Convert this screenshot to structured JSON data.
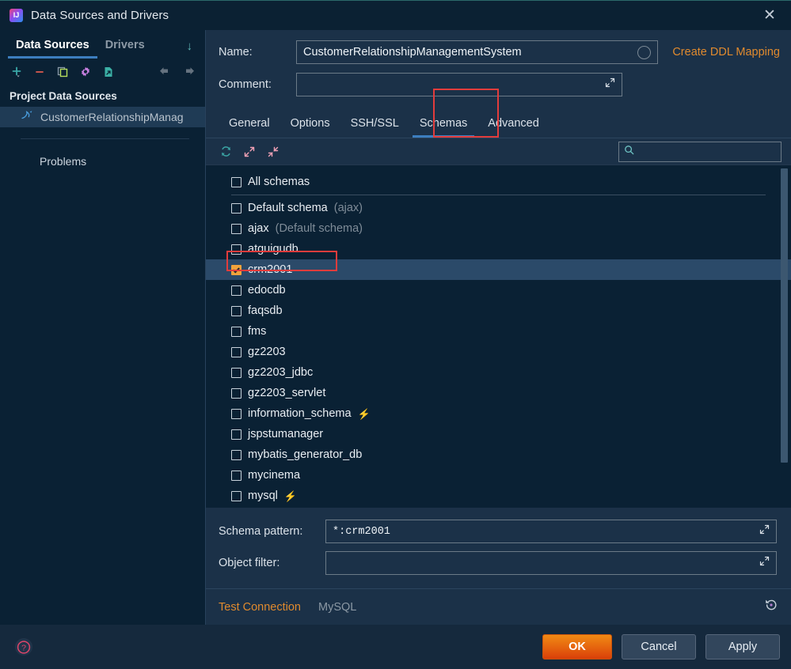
{
  "window": {
    "title": "Data Sources and Drivers",
    "app_icon": "intellij-idea-icon",
    "close_label": "✕"
  },
  "sidebar": {
    "tabs": [
      {
        "label": "Data Sources",
        "active": true
      },
      {
        "label": "Drivers",
        "active": false
      }
    ],
    "collapse_icon": "↓",
    "toolbar": [
      {
        "name": "add-button",
        "glyph": "+"
      },
      {
        "name": "remove-button",
        "glyph": "−"
      },
      {
        "name": "duplicate-button",
        "glyph": "copy"
      },
      {
        "name": "properties-button",
        "glyph": "gear"
      },
      {
        "name": "import-button",
        "glyph": "file"
      },
      {
        "name": "move-back-button",
        "glyph": "←"
      },
      {
        "name": "move-forward-button",
        "glyph": "→"
      }
    ],
    "section_title": "Project Data Sources",
    "data_source": {
      "label": "CustomerRelationshipManag",
      "icon": "mysql-dolphin-icon",
      "selected": true
    },
    "problems_label": "Problems"
  },
  "form": {
    "name_label": "Name:",
    "name_value": "CustomerRelationshipManagementSystem",
    "comment_label": "Comment:",
    "comment_value": "",
    "ddl_link": "Create DDL Mapping"
  },
  "tabs": [
    {
      "label": "General",
      "active": false
    },
    {
      "label": "Options",
      "active": false
    },
    {
      "label": "SSH/SSL",
      "active": false
    },
    {
      "label": "Schemas",
      "active": true,
      "highlighted": true
    },
    {
      "label": "Advanced",
      "active": false
    }
  ],
  "schemas_toolbar": {
    "refresh_icon": "refresh-icon",
    "expand_icon": "expand-all-icon",
    "collapse_icon": "collapse-all-icon",
    "search_placeholder": "",
    "search_value": "",
    "search_icon": "search-icon"
  },
  "schema_list": {
    "rows": [
      {
        "name": "All schemas",
        "note": "",
        "checked": false,
        "system": false,
        "selected": false,
        "separator_after": true
      },
      {
        "name": "Default schema",
        "note": "(ajax)",
        "checked": false,
        "system": false,
        "selected": false
      },
      {
        "name": "ajax",
        "note": "(Default schema)",
        "checked": false,
        "system": false,
        "selected": false
      },
      {
        "name": "atguigudb",
        "note": "",
        "checked": false,
        "system": false,
        "selected": false
      },
      {
        "name": "crm2001",
        "note": "",
        "checked": true,
        "system": false,
        "selected": true,
        "highlighted": true
      },
      {
        "name": "edocdb",
        "note": "",
        "checked": false,
        "system": false,
        "selected": false
      },
      {
        "name": "faqsdb",
        "note": "",
        "checked": false,
        "system": false,
        "selected": false
      },
      {
        "name": "fms",
        "note": "",
        "checked": false,
        "system": false,
        "selected": false
      },
      {
        "name": "gz2203",
        "note": "",
        "checked": false,
        "system": false,
        "selected": false
      },
      {
        "name": "gz2203_jdbc",
        "note": "",
        "checked": false,
        "system": false,
        "selected": false
      },
      {
        "name": "gz2203_servlet",
        "note": "",
        "checked": false,
        "system": false,
        "selected": false
      },
      {
        "name": "information_schema",
        "note": "",
        "checked": false,
        "system": true,
        "selected": false
      },
      {
        "name": "jspstumanager",
        "note": "",
        "checked": false,
        "system": false,
        "selected": false
      },
      {
        "name": "mybatis_generator_db",
        "note": "",
        "checked": false,
        "system": false,
        "selected": false
      },
      {
        "name": "mycinema",
        "note": "",
        "checked": false,
        "system": false,
        "selected": false
      },
      {
        "name": "mysql",
        "note": "",
        "checked": false,
        "system": true,
        "selected": false
      }
    ],
    "system_badge_icon": "lightning-bolt-icon"
  },
  "bottom_form": {
    "schema_pattern_label": "Schema pattern:",
    "schema_pattern_value": "*:crm2001",
    "object_filter_label": "Object filter:",
    "object_filter_value": ""
  },
  "status": {
    "test_connection_label": "Test Connection",
    "driver_label": "MySQL",
    "revert_icon": "revert-icon"
  },
  "footer": {
    "help_icon": "help-icon",
    "ok_label": "OK",
    "cancel_label": "Cancel",
    "apply_label": "Apply"
  },
  "colors": {
    "accent_blue": "#3c7ebf",
    "link_orange": "#e08a2e",
    "checked_orange": "#f0a33c",
    "highlight_red": "#e23c3c",
    "ok_gradient_from": "#f08a14",
    "ok_gradient_to": "#d93f09",
    "panel_bg": "#1b3148",
    "list_bg": "#0a2134",
    "selected_row": "#2b4a69"
  }
}
